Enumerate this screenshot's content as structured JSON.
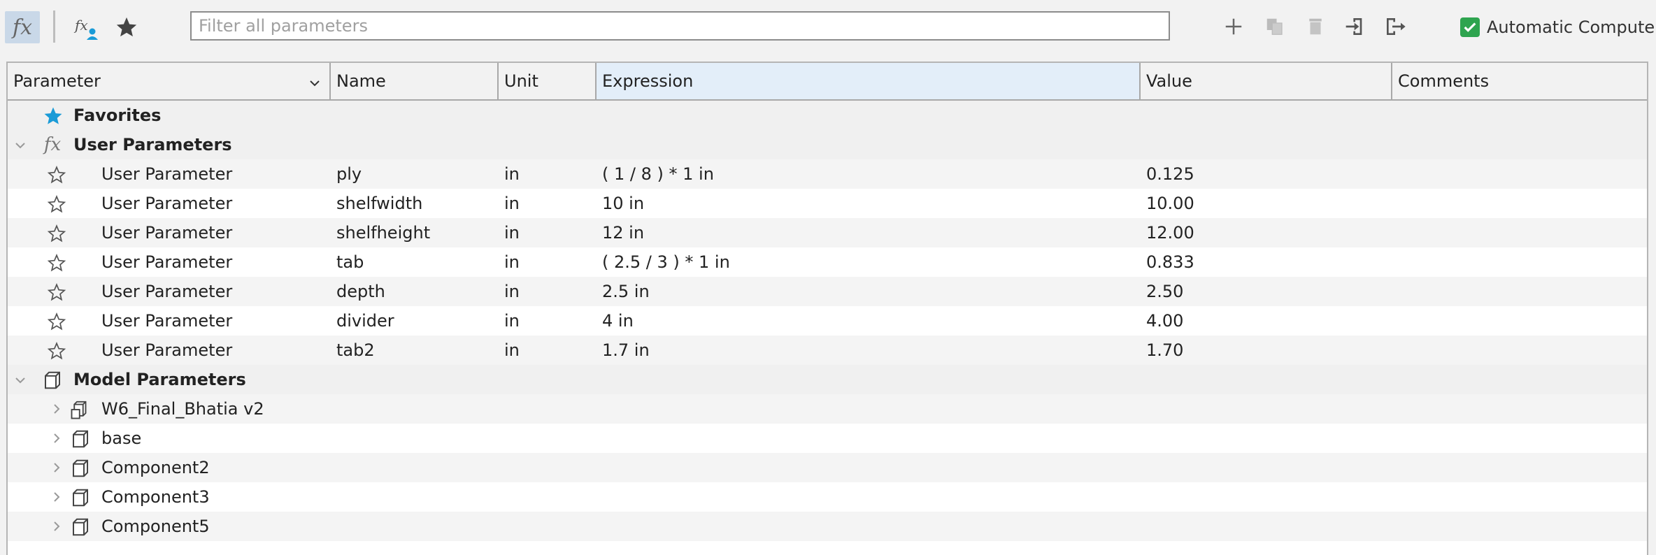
{
  "toolbar": {
    "fx_icon": "fx-icon",
    "user_params_icon": "user-parameters-filter-icon",
    "favorites_icon": "star-filled-icon",
    "filter_placeholder": "Filter all parameters",
    "actions": [
      "plus-icon",
      "copy-icon",
      "trash-icon",
      "import-icon",
      "export-icon"
    ],
    "auto_compute_label": "Automatic Compute",
    "auto_compute_checked": true
  },
  "columns": [
    "Parameter",
    "Name",
    "Unit",
    "Expression",
    "Value",
    "Comments"
  ],
  "favorites_label": "Favorites",
  "user_params_label": "User Parameters",
  "user_params": [
    {
      "type": "User Parameter",
      "name": "ply",
      "unit": "in",
      "expression": "( 1 / 8 ) * 1 in",
      "value": "0.125"
    },
    {
      "type": "User Parameter",
      "name": "shelfwidth",
      "unit": "in",
      "expression": "10 in",
      "value": "10.00"
    },
    {
      "type": "User Parameter",
      "name": "shelfheight",
      "unit": "in",
      "expression": "12 in",
      "value": "12.00"
    },
    {
      "type": "User Parameter",
      "name": "tab",
      "unit": "in",
      "expression": "( 2.5 / 3 ) * 1 in",
      "value": "0.833"
    },
    {
      "type": "User Parameter",
      "name": "depth",
      "unit": "in",
      "expression": "2.5 in",
      "value": "2.50"
    },
    {
      "type": "User Parameter",
      "name": "divider",
      "unit": "in",
      "expression": "4 in",
      "value": "4.00"
    },
    {
      "type": "User Parameter",
      "name": "tab2",
      "unit": "in",
      "expression": "1.7 in",
      "value": "1.70"
    }
  ],
  "model_params_label": "Model Parameters",
  "model_items": [
    "W6_Final_Bhatia v2",
    "base",
    "Component2",
    "Component3",
    "Component5"
  ],
  "colors": {
    "accent_star": "#1a9bd7",
    "check": "#2ea44f",
    "selected_header": "#e3eef9"
  }
}
